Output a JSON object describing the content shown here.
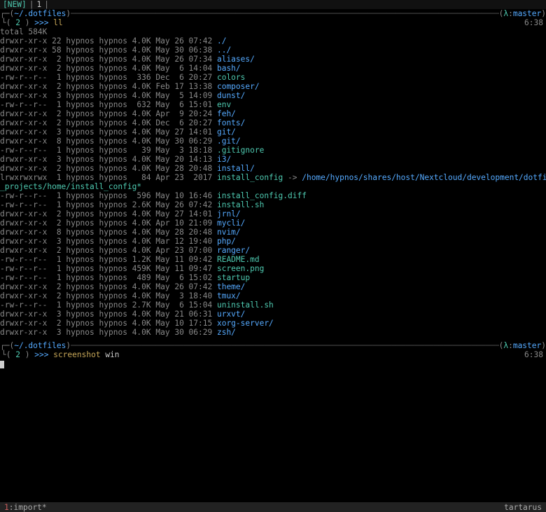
{
  "topbar": {
    "new": "[NEW]",
    "sep1": "|",
    "num": "1",
    "sep2": "|"
  },
  "header1": {
    "open": "┌─(",
    "path": "~/.dotfiles",
    "close": ")",
    "branch_open": "(",
    "lambda": "λ",
    "colon": ":",
    "branch": "master",
    "branch_close": ")"
  },
  "prompt1": {
    "open": "└(",
    "num": "2",
    "close": ")",
    "arrows": ">>>",
    "cmd": "ll",
    "clock": "6:38"
  },
  "total": "total 584K",
  "wrap": "_projects/home/install_config*",
  "listing": [
    {
      "perms": "drwxr-xr-x",
      "links": "22",
      "owner": "hypnos",
      "group": "hypnos",
      "size": "4.0K",
      "date": "May 26 07:42",
      "name": "./",
      "cls": "dir"
    },
    {
      "perms": "drwxr-xr-x",
      "links": "58",
      "owner": "hypnos",
      "group": "hypnos",
      "size": "4.0K",
      "date": "May 30 06:38",
      "name": "../",
      "cls": "dir"
    },
    {
      "perms": "drwxr-xr-x",
      "links": " 2",
      "owner": "hypnos",
      "group": "hypnos",
      "size": "4.0K",
      "date": "May 26 07:34",
      "name": "aliases/",
      "cls": "dir"
    },
    {
      "perms": "drwxr-xr-x",
      "links": " 2",
      "owner": "hypnos",
      "group": "hypnos",
      "size": "4.0K",
      "date": "May  6 14:04",
      "name": "bash/",
      "cls": "dir"
    },
    {
      "perms": "-rw-r--r--",
      "links": " 1",
      "owner": "hypnos",
      "group": "hypnos",
      "size": " 336",
      "date": "Dec  6 20:27",
      "name": "colors",
      "cls": "accent"
    },
    {
      "perms": "drwxr-xr-x",
      "links": " 2",
      "owner": "hypnos",
      "group": "hypnos",
      "size": "4.0K",
      "date": "Feb 17 13:38",
      "name": "composer/",
      "cls": "dir"
    },
    {
      "perms": "drwxr-xr-x",
      "links": " 3",
      "owner": "hypnos",
      "group": "hypnos",
      "size": "4.0K",
      "date": "May  5 14:09",
      "name": "dunst/",
      "cls": "dir"
    },
    {
      "perms": "-rw-r--r--",
      "links": " 1",
      "owner": "hypnos",
      "group": "hypnos",
      "size": " 632",
      "date": "May  6 15:01",
      "name": "env",
      "cls": "accent"
    },
    {
      "perms": "drwxr-xr-x",
      "links": " 2",
      "owner": "hypnos",
      "group": "hypnos",
      "size": "4.0K",
      "date": "Apr  9 20:24",
      "name": "feh/",
      "cls": "dir"
    },
    {
      "perms": "drwxr-xr-x",
      "links": " 2",
      "owner": "hypnos",
      "group": "hypnos",
      "size": "4.0K",
      "date": "Dec  6 20:27",
      "name": "fonts/",
      "cls": "dir"
    },
    {
      "perms": "drwxr-xr-x",
      "links": " 3",
      "owner": "hypnos",
      "group": "hypnos",
      "size": "4.0K",
      "date": "May 27 14:01",
      "name": "git/",
      "cls": "dir"
    },
    {
      "perms": "drwxr-xr-x",
      "links": " 8",
      "owner": "hypnos",
      "group": "hypnos",
      "size": "4.0K",
      "date": "May 30 06:29",
      "name": ".git/",
      "cls": "dir"
    },
    {
      "perms": "-rw-r--r--",
      "links": " 1",
      "owner": "hypnos",
      "group": "hypnos",
      "size": "  39",
      "date": "May  3 18:18",
      "name": ".gitignore",
      "cls": "accent"
    },
    {
      "perms": "drwxr-xr-x",
      "links": " 3",
      "owner": "hypnos",
      "group": "hypnos",
      "size": "4.0K",
      "date": "May 20 14:13",
      "name": "i3/",
      "cls": "dir"
    },
    {
      "perms": "drwxr-xr-x",
      "links": " 2",
      "owner": "hypnos",
      "group": "hypnos",
      "size": "4.0K",
      "date": "May 28 20:48",
      "name": "install/",
      "cls": "dir"
    },
    {
      "perms": "lrwxrwxrwx",
      "links": " 1",
      "owner": "hypnos",
      "group": "hypnos",
      "size": "  84",
      "date": "Apr 23  2017",
      "name": "install_config",
      "cls": "link",
      "arrow": " -> ",
      "target": "/home/hypnos/shares/host/Nextcloud/development/dotfiles",
      "wrapAfter": true
    },
    {
      "perms": "-rw-r--r--",
      "links": " 1",
      "owner": "hypnos",
      "group": "hypnos",
      "size": " 596",
      "date": "May 10 16:46",
      "name": "install_config.diff",
      "cls": "accent"
    },
    {
      "perms": "-rw-r--r--",
      "links": " 1",
      "owner": "hypnos",
      "group": "hypnos",
      "size": "2.6K",
      "date": "May 26 07:42",
      "name": "install.sh",
      "cls": "accent"
    },
    {
      "perms": "drwxr-xr-x",
      "links": " 2",
      "owner": "hypnos",
      "group": "hypnos",
      "size": "4.0K",
      "date": "May 27 14:01",
      "name": "jrnl/",
      "cls": "dir"
    },
    {
      "perms": "drwxr-xr-x",
      "links": " 2",
      "owner": "hypnos",
      "group": "hypnos",
      "size": "4.0K",
      "date": "Apr 10 21:09",
      "name": "mycli/",
      "cls": "dir"
    },
    {
      "perms": "drwxr-xr-x",
      "links": " 8",
      "owner": "hypnos",
      "group": "hypnos",
      "size": "4.0K",
      "date": "May 28 20:48",
      "name": "nvim/",
      "cls": "dir"
    },
    {
      "perms": "drwxr-xr-x",
      "links": " 3",
      "owner": "hypnos",
      "group": "hypnos",
      "size": "4.0K",
      "date": "Mar 12 19:40",
      "name": "php/",
      "cls": "dir"
    },
    {
      "perms": "drwxr-xr-x",
      "links": " 2",
      "owner": "hypnos",
      "group": "hypnos",
      "size": "4.0K",
      "date": "Apr 23 07:00",
      "name": "ranger/",
      "cls": "dir"
    },
    {
      "perms": "-rw-r--r--",
      "links": " 1",
      "owner": "hypnos",
      "group": "hypnos",
      "size": "1.2K",
      "date": "May 11 09:42",
      "name": "README.md",
      "cls": "accent"
    },
    {
      "perms": "-rw-r--r--",
      "links": " 1",
      "owner": "hypnos",
      "group": "hypnos",
      "size": "459K",
      "date": "May 11 09:47",
      "name": "screen.png",
      "cls": "accent"
    },
    {
      "perms": "-rw-r--r--",
      "links": " 1",
      "owner": "hypnos",
      "group": "hypnos",
      "size": " 489",
      "date": "May  6 15:02",
      "name": "startup",
      "cls": "accent"
    },
    {
      "perms": "drwxr-xr-x",
      "links": " 2",
      "owner": "hypnos",
      "group": "hypnos",
      "size": "4.0K",
      "date": "May 26 07:42",
      "name": "theme/",
      "cls": "dir"
    },
    {
      "perms": "drwxr-xr-x",
      "links": " 2",
      "owner": "hypnos",
      "group": "hypnos",
      "size": "4.0K",
      "date": "May  3 18:40",
      "name": "tmux/",
      "cls": "dir"
    },
    {
      "perms": "-rw-r--r--",
      "links": " 1",
      "owner": "hypnos",
      "group": "hypnos",
      "size": "2.7K",
      "date": "May  6 15:04",
      "name": "uninstall.sh",
      "cls": "accent"
    },
    {
      "perms": "drwxr-xr-x",
      "links": " 3",
      "owner": "hypnos",
      "group": "hypnos",
      "size": "4.0K",
      "date": "May 21 06:31",
      "name": "urxvt/",
      "cls": "dir"
    },
    {
      "perms": "drwxr-xr-x",
      "links": " 2",
      "owner": "hypnos",
      "group": "hypnos",
      "size": "4.0K",
      "date": "May 10 17:15",
      "name": "xorg-server/",
      "cls": "dir"
    },
    {
      "perms": "drwxr-xr-x",
      "links": " 3",
      "owner": "hypnos",
      "group": "hypnos",
      "size": "4.0K",
      "date": "May 30 06:29",
      "name": "zsh/",
      "cls": "dir"
    }
  ],
  "header2": {
    "open": "┌─(",
    "path": "~/.dotfiles",
    "close": ")",
    "branch_open": "(",
    "lambda": "λ",
    "colon": ":",
    "branch": "master",
    "branch_close": ")"
  },
  "prompt2": {
    "open": "└(",
    "num": "2",
    "close": ")",
    "arrows": ">>>",
    "cmd": "screenshot",
    "arg": "win",
    "clock": "6:38"
  },
  "status": {
    "winno": "1",
    "sep": ":",
    "winname": "import*",
    "host": "tartarus"
  }
}
